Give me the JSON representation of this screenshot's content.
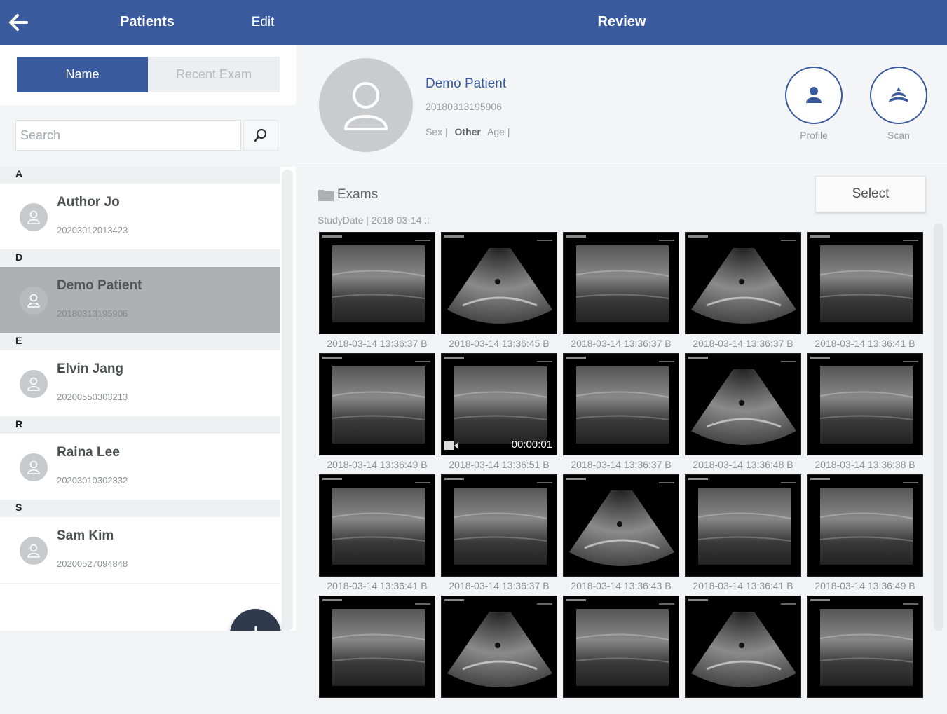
{
  "header": {
    "left_title": "Patients",
    "edit_label": "Edit",
    "right_title": "Review",
    "color": "#3a5a9e"
  },
  "sidebar": {
    "tabs": {
      "name": "Name",
      "recent": "Recent Exam"
    },
    "search_placeholder": "Search",
    "groups": [
      {
        "letter": "A",
        "patients": [
          {
            "name": "Author Jo",
            "id": "20203012013423",
            "selected": false
          }
        ]
      },
      {
        "letter": "D",
        "patients": [
          {
            "name": "Demo  Patient",
            "id": "20180313195906",
            "selected": true
          }
        ]
      },
      {
        "letter": "E",
        "patients": [
          {
            "name": "Elvin Jang",
            "id": "20200550303213",
            "selected": false
          }
        ]
      },
      {
        "letter": "R",
        "patients": [
          {
            "name": "Raina Lee",
            "id": "20203010302332",
            "selected": false
          }
        ]
      },
      {
        "letter": "S",
        "patients": [
          {
            "name": "Sam Kim",
            "id": "20200527094848",
            "selected": false
          }
        ]
      }
    ]
  },
  "patient": {
    "name": "Demo  Patient",
    "id": "20180313195906",
    "sex_label": "Sex |",
    "sex_value": "Other",
    "age_label": "Age |"
  },
  "actions": {
    "profile": "Profile",
    "scan": "Scan"
  },
  "exams": {
    "title": "Exams",
    "select_label": "Select",
    "study_date": "StudyDate | 2018-03-14 ::",
    "thumbs": [
      {
        "caption": "2018-03-14 13:36:37 B",
        "style": "rect"
      },
      {
        "caption": "2018-03-14 13:36:45 B",
        "style": "sector"
      },
      {
        "caption": "2018-03-14 13:36:37 B",
        "style": "rect"
      },
      {
        "caption": "2018-03-14 13:36:37 B",
        "style": "sector"
      },
      {
        "caption": "2018-03-14 13:36:41 B",
        "style": "rect"
      },
      {
        "caption": "2018-03-14 13:36:49 B",
        "style": "rect"
      },
      {
        "caption": "2018-03-14 13:36:51 B",
        "style": "rect",
        "video": "00:00:01"
      },
      {
        "caption": "2018-03-14 13:36:37 B",
        "style": "rect"
      },
      {
        "caption": "2018-03-14 13:36:48 B",
        "style": "sector"
      },
      {
        "caption": "2018-03-14 13:36:38 B",
        "style": "rect"
      },
      {
        "caption": "2018-03-14 13:36:41 B",
        "style": "rect"
      },
      {
        "caption": "2018-03-14 13:36:37 B",
        "style": "rect"
      },
      {
        "caption": "2018-03-14 13:36:43 B",
        "style": "sector"
      },
      {
        "caption": "2018-03-14 13:36:41 B",
        "style": "rect"
      },
      {
        "caption": "2018-03-14 13:36:49 B",
        "style": "rect"
      },
      {
        "caption": "",
        "style": "rect"
      },
      {
        "caption": "",
        "style": "sector"
      },
      {
        "caption": "",
        "style": "rect"
      },
      {
        "caption": "",
        "style": "sector"
      },
      {
        "caption": "",
        "style": "rect"
      }
    ]
  }
}
